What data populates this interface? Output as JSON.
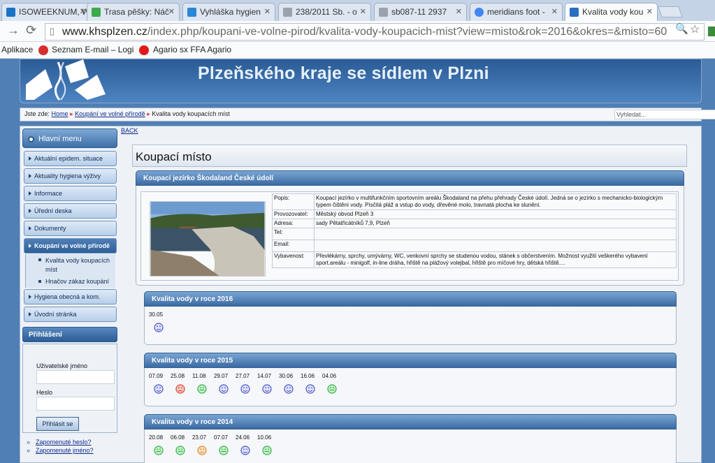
{
  "browser": {
    "tabs": [
      {
        "label": "ISOWEEKNUM, W",
        "color": "#1a73c8",
        "active": false
      },
      {
        "label": "Trasa pěšky: Náč",
        "color": "#3cab4c",
        "active": false
      },
      {
        "label": "Vyhláška hygien",
        "color": "#2b86d6",
        "active": false
      },
      {
        "label": "238/2011 Sb. - o",
        "color": "#9aa3ad",
        "active": false
      },
      {
        "label": "sb087-11 2937",
        "color": "#9aa3ad",
        "active": false
      },
      {
        "label": "meridians foot -",
        "color": "#4285f4",
        "active": false
      },
      {
        "label": "Kvalita vody kou",
        "color": "#2a6fc2",
        "active": true
      }
    ],
    "url_host": "www.khsplzen.cz",
    "url_path": "/index.php/koupani-ve-volne-pirod/kvalita-vody-koupacich-mist?view=misto&rok=2016&okres=&misto=60",
    "bookmarks": [
      "Aplikace",
      "Seznam E-mail – Logi",
      "Agario sx FFA Agario"
    ]
  },
  "site": {
    "banner_title": "Plzeňského kraje se sídlem v Plzni",
    "breadcrumb_prefix": "Jste zde:",
    "breadcrumb": [
      "Home",
      "Koupání ve volné přírodě",
      "Kvalita vody koupacích míst"
    ],
    "search_placeholder": "Vyhledat...",
    "back_label": "BACK"
  },
  "sidebar": {
    "menu_title": "Hlavní menu",
    "items": [
      "Aktuální epidem. situace",
      "Aktuality hygiena výživy",
      "Informace",
      "Úřední deska",
      "Dokumenty",
      "Koupání ve volné přírodě"
    ],
    "subitems": [
      "Kvalita vody koupacích míst",
      "Hnačov zákaz koupání"
    ],
    "items_after": [
      "Hygiena obecná a kom.",
      "Úvodní stránka"
    ],
    "login_title": "Přihlášení",
    "username_label": "Uživatelské jméno",
    "password_label": "Heslo",
    "login_button": "Přihlásit se",
    "forgot_password": "Zapomenuté heslo?",
    "forgot_username": "Zapomenuté jméno?"
  },
  "main": {
    "page_title": "Koupací místo",
    "place_title": "Koupací jezírko Škodaland České údolí",
    "info": [
      {
        "key": "Popis:",
        "value": "Koupací jezírko v multifunkčním sportovním areálu Škodaland na přehu přehrady České údolí. Jedná se o jezírko s mechanicko-biologickým typem čištění vody. Písčitá pláž a vstup do vody, dřevěné molo, travnatá plocha ke slunění."
      },
      {
        "key": "Provozovatel:",
        "value": "Městský obvod Plzeň 3"
      },
      {
        "key": "Adresa:",
        "value": "sady Pětatřicátníků 7,9, Plzeň"
      },
      {
        "key": "Tel:",
        "value": ""
      },
      {
        "key": "Email:",
        "value": ""
      },
      {
        "key": "Vybavenost:",
        "value": "Převlékárny, sprchy, umývárny, WC, venkovní sprchy se studenou vodou, stánek s občerstvením. Možnost využití veškerého vybavení sport.areálu - minigolf, in-line dráha, hřiště na plážový volejbal, hřiště pro míčové hry, dětská hřiště...."
      }
    ],
    "years": [
      {
        "title": "Kvalita vody v roce 2016",
        "measurements": [
          {
            "date": "30.05",
            "status": "blue"
          }
        ]
      },
      {
        "title": "Kvalita vody v roce 2015",
        "measurements": [
          {
            "date": "07.09",
            "status": "blue"
          },
          {
            "date": "25.08",
            "status": "red"
          },
          {
            "date": "11.08",
            "status": "green"
          },
          {
            "date": "29.07",
            "status": "blue"
          },
          {
            "date": "27.07",
            "status": "blue"
          },
          {
            "date": "14.07",
            "status": "blue"
          },
          {
            "date": "30.06",
            "status": "blue"
          },
          {
            "date": "16.06",
            "status": "blue"
          },
          {
            "date": "04.06",
            "status": "green"
          }
        ]
      },
      {
        "title": "Kvalita vody v roce 2014",
        "measurements": [
          {
            "date": "20.08",
            "status": "green"
          },
          {
            "date": "06.08",
            "status": "green"
          },
          {
            "date": "23.07",
            "status": "orange"
          },
          {
            "date": "07.07",
            "status": "green"
          },
          {
            "date": "24.06",
            "status": "blue"
          },
          {
            "date": "10.06",
            "status": "green"
          }
        ]
      }
    ],
    "status_colors": {
      "blue": "#4a55c8",
      "green": "#33b34a",
      "red": "#d9473a",
      "orange": "#e0892a"
    }
  }
}
